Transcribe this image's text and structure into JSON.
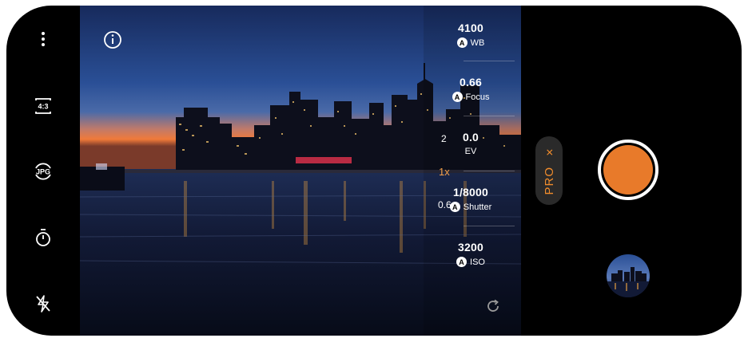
{
  "colors": {
    "accent": "#f08c2c",
    "shutter": "#e87a2a",
    "background": "#000000",
    "sky_top": "#1a2f63",
    "sunset": "#f07a3a"
  },
  "left_rail": {
    "items": [
      {
        "name": "more-options",
        "icon": "vertical-dots-icon"
      },
      {
        "name": "aspect-ratio",
        "icon": "aspect-ratio-icon",
        "label": "4:3"
      },
      {
        "name": "format",
        "icon": "format-icon",
        "label": "JPG"
      },
      {
        "name": "timer",
        "icon": "timer-icon"
      },
      {
        "name": "flash",
        "icon": "flash-off-icon"
      }
    ]
  },
  "viewfinder": {
    "info_icon": "info-icon",
    "settings": [
      {
        "value": "4100",
        "label": "WB",
        "badge": "A"
      },
      {
        "value": "0.66",
        "label": "Focus",
        "badge": "A"
      },
      {
        "value": "0.0",
        "label": "EV",
        "badge": ""
      },
      {
        "value": "1/8000",
        "label": "Shutter",
        "badge": "A"
      },
      {
        "value": "3200",
        "label": "ISO",
        "badge": "A"
      }
    ],
    "zoom": {
      "levels": [
        "2",
        "1x",
        "0.6"
      ],
      "active": "1x"
    },
    "reset_icon": "reset-icon"
  },
  "right_panel": {
    "mode_label": "PRO",
    "mode_close": "×",
    "shutter_icon": "shutter-button",
    "gallery_icon": "gallery-thumbnail"
  }
}
